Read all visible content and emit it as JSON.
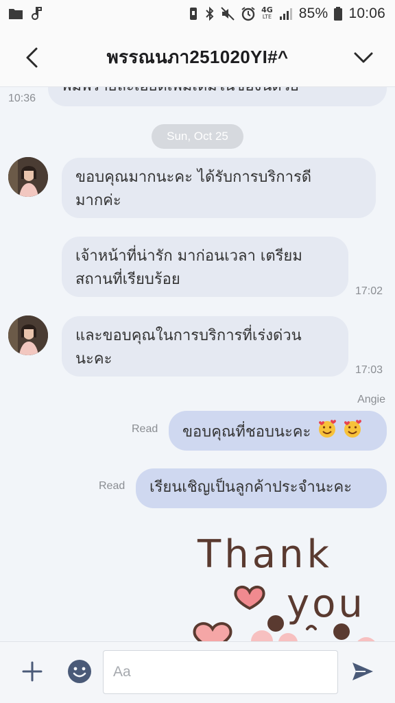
{
  "status_bar": {
    "network": "4G",
    "network_sub": "LTE",
    "battery": "85%",
    "clock": "10:06"
  },
  "header": {
    "title": "พรรณนภา251020YI#^"
  },
  "chat": {
    "partial_message": {
      "text": "พิมพ์รายละเอียดเพิ่มเติมในช่องนี้ด้วย",
      "time": "10:36"
    },
    "date_separator": "Sun, Oct 25",
    "messages": [
      {
        "lines": [
          "ขอบคุณมากนะคะ ได้รับการบริการดี",
          "มากค่ะ"
        ],
        "time": ""
      },
      {
        "lines": [
          "เจ้าหน้าที่น่ารัก มาก่อนเวลา เตรียม",
          "สถานที่เรียบร้อย"
        ],
        "time": "17:02"
      },
      {
        "lines": [
          "และขอบคุณในการบริการที่เร่งด่วน",
          "นะคะ"
        ],
        "time": "17:03"
      }
    ],
    "sender_name": "Angie",
    "outgoing": [
      {
        "text": "ขอบคุณที่ชอบนะคะ",
        "status": "Read",
        "emoji": "smiling-face-with-hearts"
      },
      {
        "text": "เรียนเชิญเป็นลูกค้าประจำนะคะ",
        "status": "Read"
      }
    ],
    "sticker": {
      "line1": "Thank",
      "line2": "you"
    }
  },
  "input_bar": {
    "placeholder": "Aa"
  },
  "colors": {
    "incoming_bubble": "#e5e9f2",
    "outgoing_bubble": "#cfd8f0",
    "chat_background": "#f2f5f9",
    "accent_icon": "#4a5a78"
  },
  "icons": [
    "folder-icon",
    "music-note-icon",
    "vibrate-icon",
    "bluetooth-icon",
    "mute-icon",
    "alarm-icon",
    "signal-icon",
    "battery-icon",
    "back-arrow-icon",
    "chevron-down-icon",
    "plus-icon",
    "emoji-icon",
    "send-icon"
  ]
}
